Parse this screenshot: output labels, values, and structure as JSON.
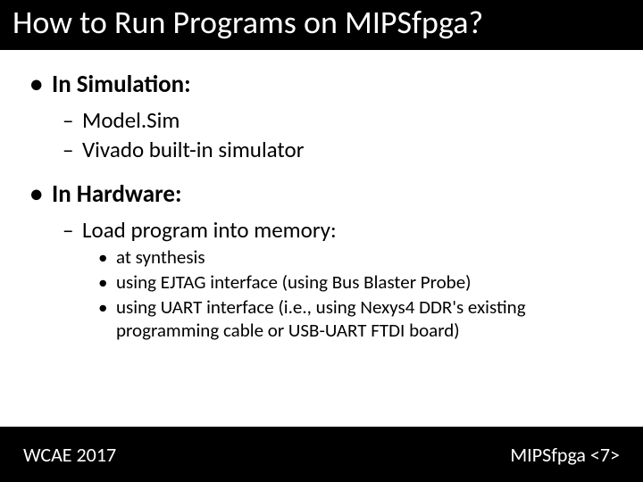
{
  "title": "How to Run Programs on MIPSfpga?",
  "sections": [
    {
      "heading": "In Simulation:",
      "items_l2": [
        {
          "text": "Model.Sim"
        },
        {
          "text": "Vivado built-in simulator"
        }
      ]
    },
    {
      "heading": "In Hardware:",
      "items_l2": [
        {
          "text": "Load program into memory:",
          "items_l3": [
            "at synthesis",
            "using EJTAG interface (using Bus Blaster Probe)",
            "using UART interface (i.e., using Nexys4 DDR's existing programming cable or USB-UART FTDI board)"
          ]
        }
      ]
    }
  ],
  "footer": {
    "left": "WCAE 2017",
    "right": "MIPSfpga <7>"
  }
}
